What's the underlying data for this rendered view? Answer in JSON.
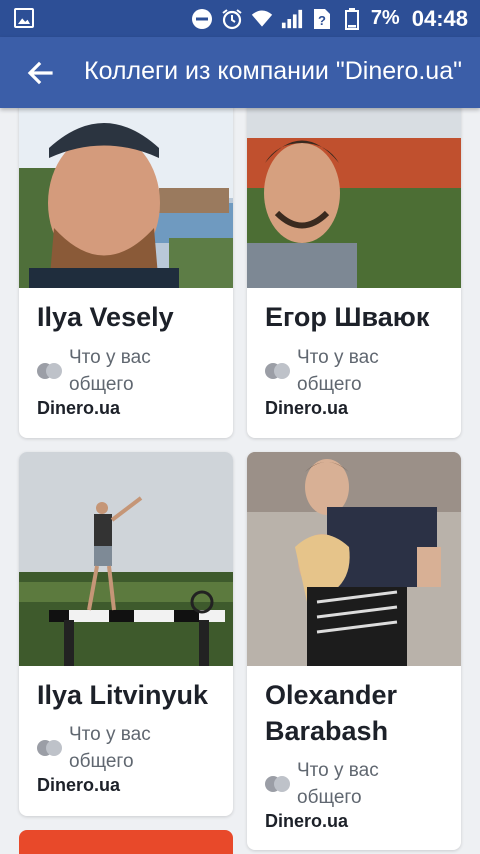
{
  "status_bar": {
    "battery_percent": "7%",
    "time": "04:48",
    "icons": [
      "image-icon",
      "do-not-disturb-icon",
      "alarm-icon",
      "wifi-icon",
      "signal-icon",
      "no-sim-icon",
      "battery-icon"
    ]
  },
  "app_bar": {
    "title": "Коллеги из компании \"Dinero.ua\""
  },
  "people": [
    {
      "name": "Ilya Vesely",
      "mutual": "Что у вас общего",
      "company": "Dinero.ua"
    },
    {
      "name": "Егор Шваюк",
      "mutual": "Что у вас общего",
      "company": "Dinero.ua"
    },
    {
      "name": "Ilya Litvinyuk",
      "mutual": "Что у вас общего",
      "company": "Dinero.ua"
    },
    {
      "name": "Olexander Barabash",
      "mutual": "Что у вас общего",
      "company": "Dinero.ua"
    }
  ],
  "colors": {
    "status_bar": "#2d4f96",
    "app_bar": "#3b5ea8",
    "background": "#eef0f3"
  }
}
